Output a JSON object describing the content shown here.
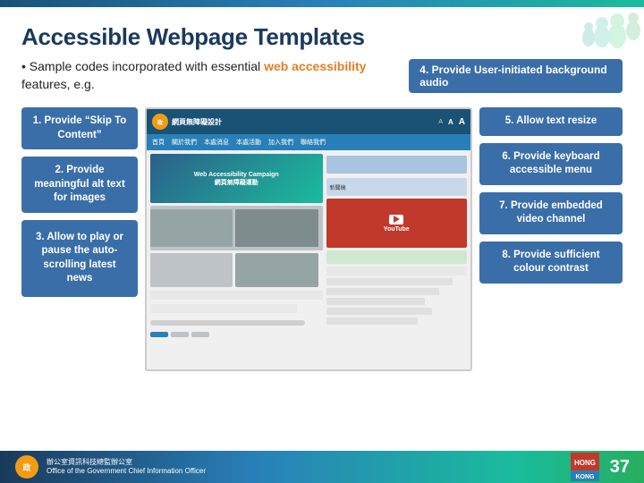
{
  "page": {
    "title": "Accessible Webpage Templates",
    "subtitle_prefix": "Sample codes incorporated with essential ",
    "subtitle_link": "web accessibility",
    "subtitle_suffix": " features, e.g.",
    "callout": "4. Provide User-initiated background audio",
    "page_number": "37"
  },
  "left_features": [
    {
      "id": "feature-1",
      "label": "1. Provide “Skip To Content”"
    },
    {
      "id": "feature-2",
      "label": "2. Provide meaningful alt text for images"
    },
    {
      "id": "feature-3",
      "label": "3. Allow to play or pause the auto-scrolling latest news"
    }
  ],
  "right_features": [
    {
      "id": "feature-5",
      "label": "5. Allow text resize"
    },
    {
      "id": "feature-6",
      "label": "6. Provide keyboard accessible menu"
    },
    {
      "id": "feature-7",
      "label": "7. Provide embedded video channel"
    },
    {
      "id": "feature-8",
      "label": "8. Provide sufficient colour contrast"
    }
  ],
  "webpage_mockup": {
    "header_text": "網頁無障礙設計",
    "nav_items": [
      "首頁",
      "關於我們",
      "本處消息",
      "本處活動",
      "加入我們",
      "聯絡我們"
    ],
    "banner_text": "Web Accessibility Campaign\n網頁無障礙運動",
    "video_label": "YouTube"
  },
  "footer": {
    "org_line1": "辦公室資訊科技總監辦公室",
    "org_line2": "Office of the Government Chief Information Officer"
  },
  "colors": {
    "primary_blue": "#1a3a5c",
    "accent_blue": "#3a6ea8",
    "accent_orange": "#e67e22",
    "green": "#27ae60",
    "bottom_bar": "#1a3a5c"
  }
}
